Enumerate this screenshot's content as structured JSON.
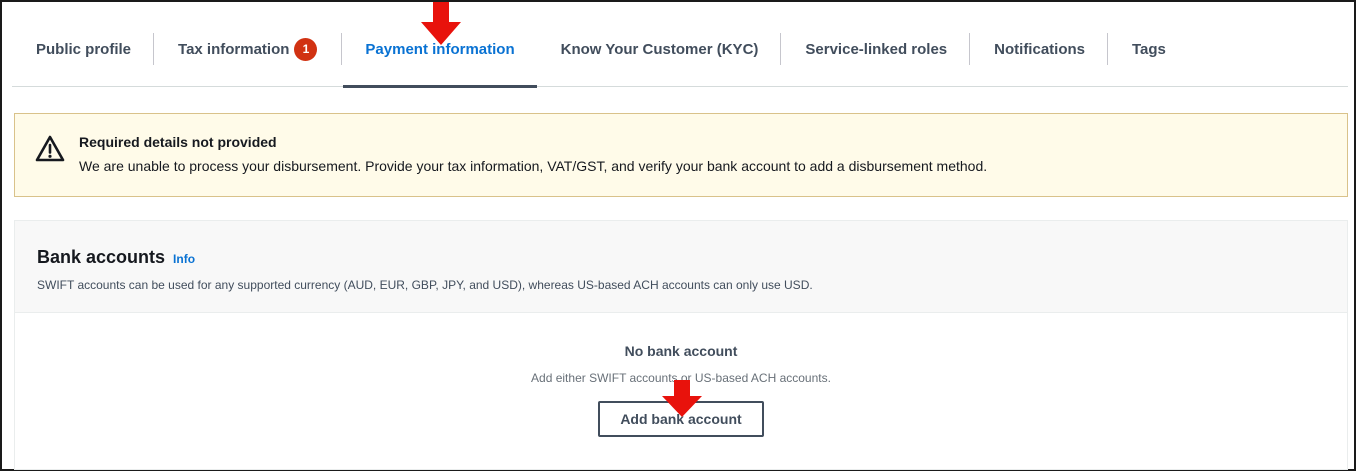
{
  "tabs": [
    {
      "label": "Public profile",
      "active": false
    },
    {
      "label": "Tax information",
      "badge": "1",
      "active": false
    },
    {
      "label": "Payment information",
      "active": true
    },
    {
      "label": "Know Your Customer (KYC)",
      "active": false
    },
    {
      "label": "Service-linked roles",
      "active": false
    },
    {
      "label": "Notifications",
      "active": false
    },
    {
      "label": "Tags",
      "active": false
    }
  ],
  "alert": {
    "icon": "warning-icon",
    "title": "Required details not provided",
    "body": "We are unable to process your disbursement. Provide your tax information, VAT/GST, and verify your bank account to add a disbursement method."
  },
  "bank_accounts": {
    "title": "Bank accounts",
    "info_label": "Info",
    "description": "SWIFT accounts can be used for any supported currency (AUD, EUR, GBP, JPY, and USD), whereas US-based ACH accounts can only use USD.",
    "empty_title": "No bank account",
    "empty_description": "Add either SWIFT accounts or US-based ACH accounts.",
    "add_button_label": "Add bank account"
  },
  "colors": {
    "accent": "#0972d3",
    "badge": "#d13212",
    "annotation_arrow": "#e8120c",
    "warning_bg": "#fffbe9"
  }
}
